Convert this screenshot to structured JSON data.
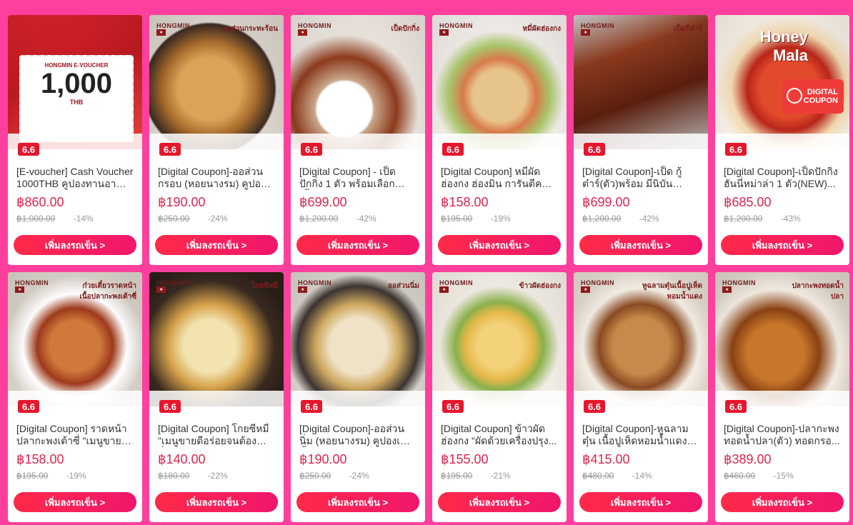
{
  "button_label": "เพิ่มลงรถเข็น >",
  "promo_badge": "6.6",
  "products": [
    {
      "title": "[E-voucher] Cash Voucher 1000THB คูปองทานอาหา...",
      "price": "฿860.00",
      "original": "฿1,000.00",
      "discount": "-14%",
      "img_brand": "HONGMIN",
      "img_caption": "",
      "voucher_head": "HONGMIN E-VOUCHER",
      "voucher_amount": "1,000",
      "voucher_unit": "THB"
    },
    {
      "title": "[Digital Coupon]-ออส่วน กรอบ (หอยนางรม) คูปองใ...",
      "price": "฿190.00",
      "original": "฿250.00",
      "discount": "-24%",
      "img_brand": "HONGMIN",
      "img_caption": "ออส่วนกระทะร้อน"
    },
    {
      "title": "[Digital Coupon] - เป็ด ปักกิ่ง 1 ตัว พร้อมเลือกเนื้อ...",
      "price": "฿699.00",
      "original": "฿1,200.00",
      "discount": "-42%",
      "img_brand": "HONGMIN",
      "img_caption": "เป็ดปักกิ่ง"
    },
    {
      "title": "[Digital Coupon] หมี่ผัด ฮ่องกง ฮ่องมิน การันตีควา...",
      "price": "฿158.00",
      "original": "฿195.00",
      "discount": "-19%",
      "img_brand": "HONGMIN",
      "img_caption": "หมี่ผัดฮ่องกง"
    },
    {
      "title": "[Digital Coupon]-เป็ด กู้ต๋าร์(ตัว)พร้อม มีนิบันนุ่มๆ...",
      "price": "฿699.00",
      "original": "฿1,200.00",
      "discount": "-42%",
      "img_brand": "HONGMIN",
      "img_caption": "เป็ดกีต๋าร์"
    },
    {
      "title": "[Digital Coupon]-เป็ดปักกิ่ง ฮันนี่หม่าล่า 1 ตัว(NEW)...",
      "price": "฿685.00",
      "original": "฿1,200.00",
      "discount": "-43%",
      "img_brand": "",
      "img_caption": "Honey Mala",
      "dc_line1": "DIGITAL",
      "dc_line2": "COUPON"
    },
    {
      "title": "[Digital Coupon] ราดหน้า ปลากะพงเต้าซี่ \"เมนูขายดี...",
      "price": "฿158.00",
      "original": "฿195.00",
      "discount": "-19%",
      "img_brand": "HONGMIN",
      "img_caption": "ก๋วยเตี๋ยวราดหน้าเนื้อปลากะพงเต้าซี่"
    },
    {
      "title": "[Digital Coupon] โกยซีหมี่ \"เมนูขายดีอร่อยจนต้องสั่ง...",
      "price": "฿140.00",
      "original": "฿180.00",
      "discount": "-22%",
      "img_brand": "HONGMIN",
      "img_caption": "โกยซีหมี่"
    },
    {
      "title": "[Digital Coupon]-ออส่วนนิ่ม (หอยนางรม) คูปองเมนูนี้...",
      "price": "฿190.00",
      "original": "฿250.00",
      "discount": "-24%",
      "img_brand": "HONGMIN",
      "img_caption": "ออส่วนนิ่ม"
    },
    {
      "title": "[Digital Coupon] ข้าวผัด ฮ่องกง \"ผัดด้วยเครื่องปรุง...",
      "price": "฿155.00",
      "original": "฿195.00",
      "discount": "-21%",
      "img_brand": "HONGMIN",
      "img_caption": "ข้าวผัดฮ่องกง"
    },
    {
      "title": "[Digital Coupon]-หูฉลามตุ๋น เนื้อปูเห็ดหอมน้ำแดง คูปอ...",
      "price": "฿415.00",
      "original": "฿480.00",
      "discount": "-14%",
      "img_brand": "HONGMIN",
      "img_caption": "หูฉลามตุ๋นเนื้อปูเห็ดหอมน้ำแดง"
    },
    {
      "title": "[Digital Coupon]-ปลากะพง ทอดน้ำปลา(ตัว) ทอดกรอ...",
      "price": "฿389.00",
      "original": "฿460.00",
      "discount": "-15%",
      "img_brand": "HONGMIN",
      "img_caption": "ปลากะพงทอดน้ำปลา"
    }
  ]
}
